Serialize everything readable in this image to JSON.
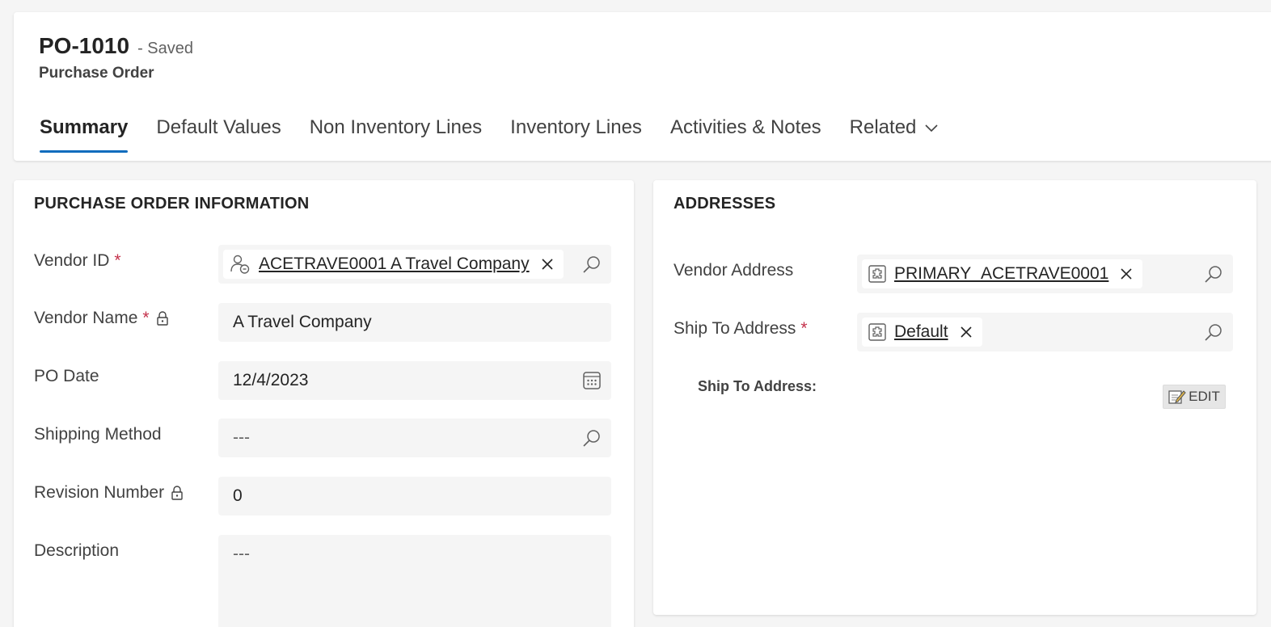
{
  "record": {
    "title": "PO-1010",
    "status": "- Saved",
    "entity": "Purchase Order"
  },
  "tabs": [
    {
      "label": "Summary",
      "active": true
    },
    {
      "label": "Default Values"
    },
    {
      "label": "Non Inventory Lines"
    },
    {
      "label": "Inventory Lines"
    },
    {
      "label": "Activities & Notes"
    },
    {
      "label": "Related"
    }
  ],
  "po_info": {
    "section_title": "PURCHASE ORDER INFORMATION",
    "vendor_id": {
      "label": "Vendor ID",
      "required": "*",
      "value": "ACETRAVE0001 A Travel Company"
    },
    "vendor_name": {
      "label": "Vendor Name",
      "required": "*",
      "value": "A Travel Company"
    },
    "po_date": {
      "label": "PO Date",
      "value": "12/4/2023"
    },
    "shipping_method": {
      "label": "Shipping Method",
      "value": "---"
    },
    "revision_number": {
      "label": "Revision Number",
      "value": "0"
    },
    "description": {
      "label": "Description",
      "value": "---"
    }
  },
  "addresses": {
    "section_title": "ADDRESSES",
    "vendor_address": {
      "label": "Vendor Address",
      "value": "PRIMARY_ACETRAVE0001"
    },
    "ship_to_address": {
      "label": "Ship To Address",
      "required": "*",
      "value": "Default"
    },
    "ship_to_subheading": "Ship To Address:",
    "edit_label": "EDIT"
  },
  "colors": {
    "accent": "#0f6cbd",
    "required": "#c4314b",
    "input_bg": "#f5f5f5"
  }
}
